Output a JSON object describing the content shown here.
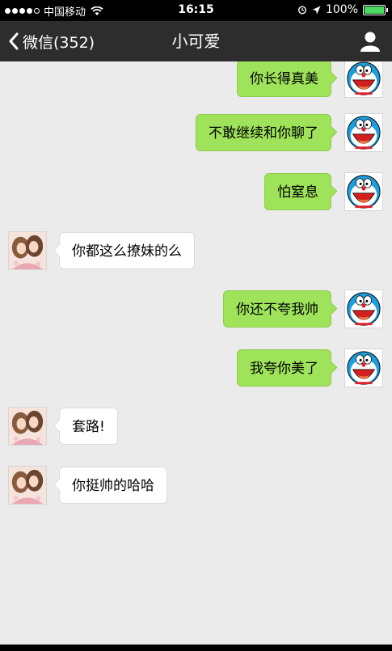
{
  "status_bar": {
    "carrier": "中国移动",
    "time": "16:15",
    "battery": "100%",
    "battery_level": 1.0,
    "signal_bars": 4,
    "signal_total": 5
  },
  "nav": {
    "back_label": "微信(352)",
    "title": "小可爱",
    "colors": {
      "background": "#2d2d2d",
      "text": "#ffffff"
    }
  },
  "messages": [
    {
      "sender": "self",
      "text": "你长得真美"
    },
    {
      "sender": "self",
      "text": "不敢继续和你聊了"
    },
    {
      "sender": "self",
      "text": "怕窒息"
    },
    {
      "sender": "other",
      "text": "你都这么撩妹的么"
    },
    {
      "sender": "self",
      "text": "你还不夸我帅"
    },
    {
      "sender": "self",
      "text": "我夸你美了"
    },
    {
      "sender": "other",
      "text": "套路!"
    },
    {
      "sender": "other",
      "text": "你挺帅的哈哈"
    }
  ],
  "colors": {
    "chat_background": "#ebebeb",
    "self_bubble": "#9fe35b",
    "other_bubble": "#ffffff"
  }
}
